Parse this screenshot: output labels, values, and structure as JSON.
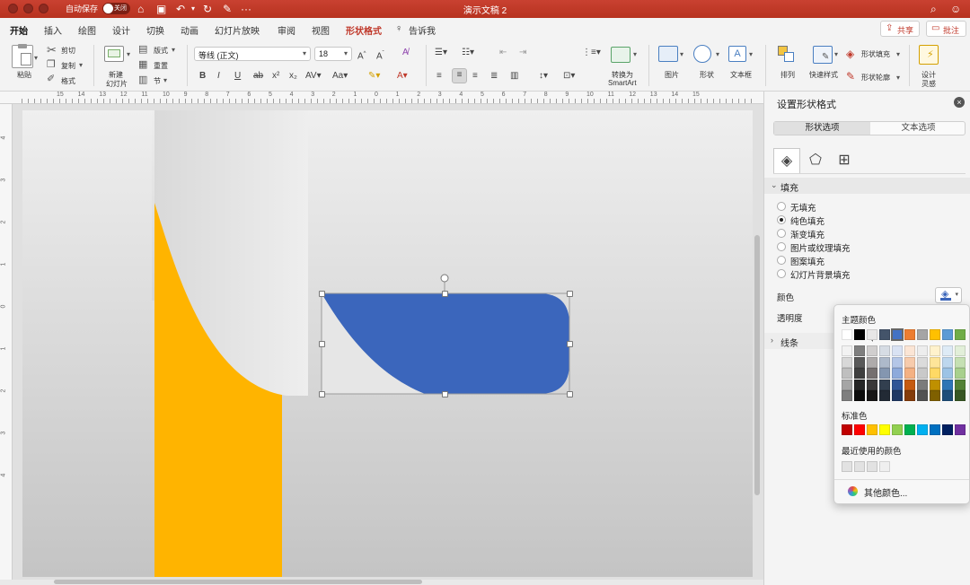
{
  "titlebar": {
    "autosave_label": "自动保存",
    "autosave_state": "关闭",
    "doc_title": "演示文稿 2",
    "more": "···"
  },
  "tabs": [
    {
      "label": "开始",
      "active": true
    },
    {
      "label": "插入"
    },
    {
      "label": "绘图"
    },
    {
      "label": "设计"
    },
    {
      "label": "切换"
    },
    {
      "label": "动画"
    },
    {
      "label": "幻灯片放映"
    },
    {
      "label": "审阅"
    },
    {
      "label": "视图"
    },
    {
      "label": "形状格式",
      "contextual": true
    },
    {
      "label": "告诉我"
    }
  ],
  "share_label": "共享",
  "comments_label": "批注",
  "ribbon": {
    "paste": "粘贴",
    "cut": "剪切",
    "copy": "复制",
    "format_painter": "格式",
    "new_slide": [
      "新建",
      "幻灯片"
    ],
    "layout": "版式",
    "reset": "重置",
    "section": "节",
    "font_name": "等线 (正文)",
    "font_size": "18",
    "convert_smartart": [
      "转换为",
      "SmartArt"
    ],
    "picture": "图片",
    "shape": "形状",
    "textbox": "文本框",
    "arrange": "排列",
    "quick_styles": "快速样式",
    "shape_fill": "形状填充",
    "shape_outline": "形状轮廓",
    "designer": [
      "设计",
      "灵感"
    ]
  },
  "ruler": {
    "h_numbers": [
      "15",
      "14",
      "13",
      "12",
      "11",
      "10",
      "9",
      "8",
      "7",
      "6",
      "5",
      "4",
      "3",
      "2",
      "1",
      "0",
      "1",
      "2",
      "3",
      "4",
      "5",
      "6",
      "7",
      "8",
      "9",
      "10",
      "11",
      "12",
      "13",
      "14",
      "15"
    ],
    "v_numbers": [
      "4",
      "3",
      "2",
      "1",
      "0",
      "1",
      "2",
      "3",
      "4"
    ]
  },
  "slide": {
    "colors": {
      "yellow": "#FFB400",
      "blue": "#3B66BC",
      "background_top": "#EFEFEF",
      "background_bottom": "#C4C4C4"
    }
  },
  "pane": {
    "title": "设置形状格式",
    "tab_shape": "形状选项",
    "tab_text": "文本选项",
    "fill_section": "填充",
    "fill_options": [
      {
        "label": "无填充",
        "selected": false
      },
      {
        "label": "纯色填充",
        "selected": true
      },
      {
        "label": "渐变填充",
        "selected": false
      },
      {
        "label": "图片或纹理填充",
        "selected": false
      },
      {
        "label": "图案填充",
        "selected": false
      },
      {
        "label": "幻灯片背景填充",
        "selected": false
      }
    ],
    "color_label": "颜色",
    "transparency_label": "透明度",
    "line_section": "线条"
  },
  "color_popup": {
    "theme_title": "主题颜色",
    "theme_top": [
      "#FFFFFF",
      "#000000",
      "#E7E6E6",
      "#44546A",
      "#4472C4",
      "#ED7D31",
      "#A5A5A5",
      "#FFC000",
      "#5B9BD5",
      "#70AD47"
    ],
    "theme_shades": [
      [
        "#F2F2F2",
        "#7F7F7F",
        "#D0CECE",
        "#D6DCE4",
        "#D9E2F3",
        "#FBE5D5",
        "#EDEDED",
        "#FFF2CC",
        "#DEEBF6",
        "#E2EFD9"
      ],
      [
        "#D8D8D8",
        "#595959",
        "#AEABAB",
        "#ADB9CA",
        "#B4C6E7",
        "#F7CBAC",
        "#DBDBDB",
        "#FEE599",
        "#BDD7EE",
        "#C5E0B3"
      ],
      [
        "#BFBFBF",
        "#3F3F3F",
        "#757070",
        "#8496B0",
        "#8EAADB",
        "#F4B183",
        "#C9C9C9",
        "#FFD965",
        "#9CC3E5",
        "#A8D08D"
      ],
      [
        "#A5A5A5",
        "#262626",
        "#3A3838",
        "#323F4F",
        "#2F5496",
        "#C55A11",
        "#7B7B7B",
        "#BF9000",
        "#2E75B5",
        "#538135"
      ],
      [
        "#7F7F7F",
        "#0C0C0C",
        "#171616",
        "#222A35",
        "#1F3864",
        "#843C0B",
        "#525252",
        "#7F6000",
        "#1E4E79",
        "#375623"
      ]
    ],
    "standard_title": "标准色",
    "standard": [
      "#C00000",
      "#FF0000",
      "#FFC000",
      "#FFFF00",
      "#92D050",
      "#00B050",
      "#00B0F0",
      "#0070C0",
      "#002060",
      "#7030A0"
    ],
    "recent_title": "最近使用的颜色",
    "recent": [
      "#E2E2E2",
      "#E2E2E2",
      "#E2E2E2",
      "#EFEFEF"
    ],
    "more_colors": "其他颜色..."
  }
}
